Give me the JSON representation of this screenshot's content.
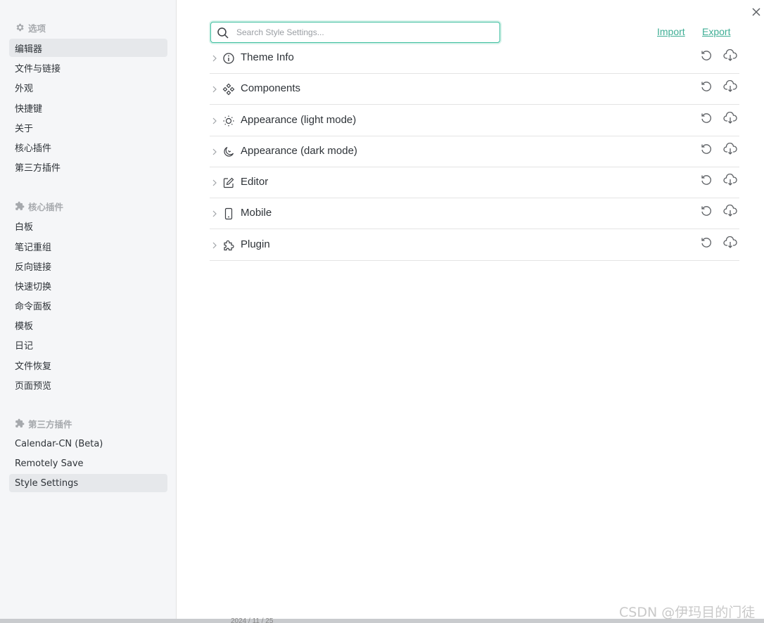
{
  "sidebar": {
    "options_header": "选项",
    "options_items": [
      {
        "label": "编辑器",
        "active": true
      },
      {
        "label": "文件与链接",
        "active": false
      },
      {
        "label": "外观",
        "active": false
      },
      {
        "label": "快捷键",
        "active": false
      },
      {
        "label": "关于",
        "active": false
      },
      {
        "label": "核心插件",
        "active": false
      },
      {
        "label": "第三方插件",
        "active": false
      }
    ],
    "core_header": "核心插件",
    "core_items": [
      {
        "label": "白板"
      },
      {
        "label": "笔记重组"
      },
      {
        "label": "反向链接"
      },
      {
        "label": "快速切换"
      },
      {
        "label": "命令面板"
      },
      {
        "label": "模板"
      },
      {
        "label": "日记"
      },
      {
        "label": "文件恢复"
      },
      {
        "label": "页面预览"
      }
    ],
    "community_header": "第三方插件",
    "community_items": [
      {
        "label": "Calendar-CN (Beta)",
        "active": false
      },
      {
        "label": "Remotely Save",
        "active": false
      },
      {
        "label": "Style Settings",
        "active": true
      }
    ]
  },
  "search": {
    "placeholder": "Search Style Settings...",
    "value": ""
  },
  "actions": {
    "import_label": "Import",
    "export_label": "Export"
  },
  "sections": [
    {
      "label": "Theme Info",
      "icon": "info-icon"
    },
    {
      "label": "Components",
      "icon": "components-icon"
    },
    {
      "label": "Appearance (light mode)",
      "icon": "sun-icon"
    },
    {
      "label": "Appearance (dark mode)",
      "icon": "moon-icon"
    },
    {
      "label": "Editor",
      "icon": "edit-icon"
    },
    {
      "label": "Mobile",
      "icon": "mobile-icon"
    },
    {
      "label": "Plugin",
      "icon": "puzzle-icon"
    }
  ],
  "watermark": "CSDN @伊玛目的门徒",
  "bottom_text": "2024 / 11 / 25",
  "colors": {
    "accent": "#3fbfa0",
    "link": "#3fae95",
    "sidebar_bg": "#f5f6f8",
    "active_bg": "#e6e8eb"
  }
}
